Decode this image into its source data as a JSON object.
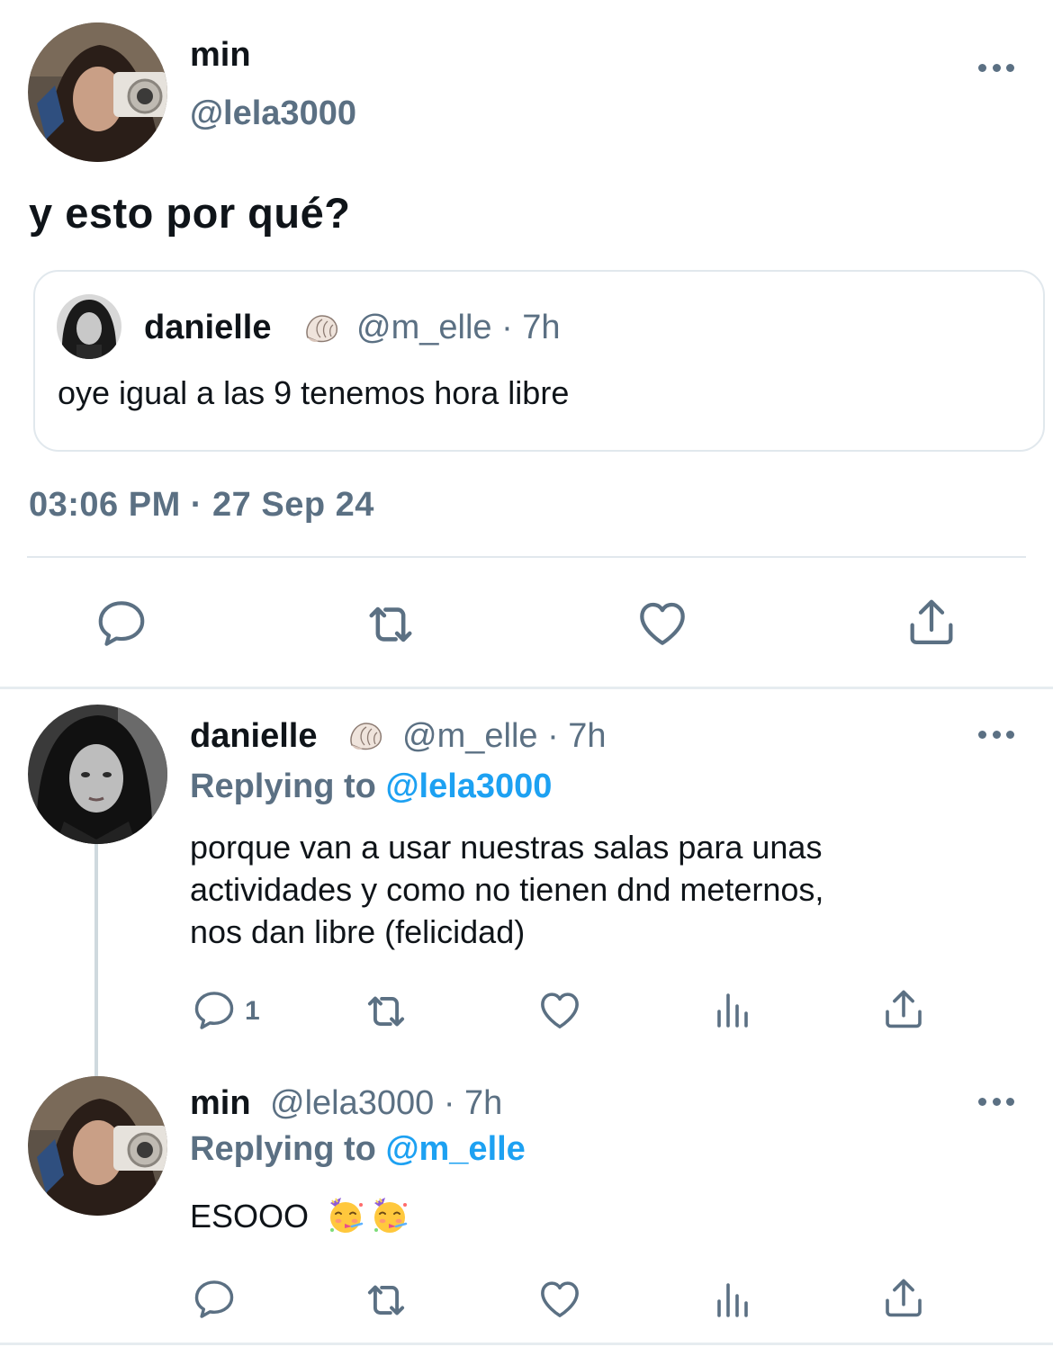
{
  "main_tweet": {
    "name": "min",
    "handle": "@lela3000",
    "text": "y esto por qué?",
    "timestamp": "03:06 PM · 27 Sep 24",
    "quote": {
      "name": "danielle",
      "name_emoji": "shell-emoji",
      "meta": "@m_elle · 7h",
      "text": "oye igual a las 9 tenemos hora libre"
    },
    "actions": [
      "reply-icon",
      "retweet-icon",
      "like-icon",
      "share-icon"
    ]
  },
  "replies": [
    {
      "name": "danielle",
      "name_emoji": "shell-emoji",
      "meta": "@m_elle · 7h",
      "replying_prefix": "Replying to",
      "replying_to": "@lela3000",
      "lines": [
        "porque van a usar nuestras salas para unas",
        "actividades y como no tienen dnd meternos,",
        "nos dan libre (felicidad)"
      ],
      "reply_count": "1",
      "actions": [
        "reply-icon",
        "retweet-icon",
        "like-icon",
        "analytics-icon",
        "share-icon"
      ]
    },
    {
      "name": "min",
      "meta": "@lela3000 · 7h",
      "replying_prefix": "Replying to",
      "replying_to": "@m_elle",
      "text": "ESOOO",
      "text_emoji": [
        "partying-face-emoji",
        "partying-face-emoji"
      ],
      "actions": [
        "reply-icon",
        "retweet-icon",
        "like-icon",
        "analytics-icon",
        "share-icon"
      ]
    }
  ],
  "colors": {
    "text": "#0f1419",
    "secondary": "#5b7083",
    "mention": "#1da1f2",
    "border": "#e1e8ed"
  }
}
